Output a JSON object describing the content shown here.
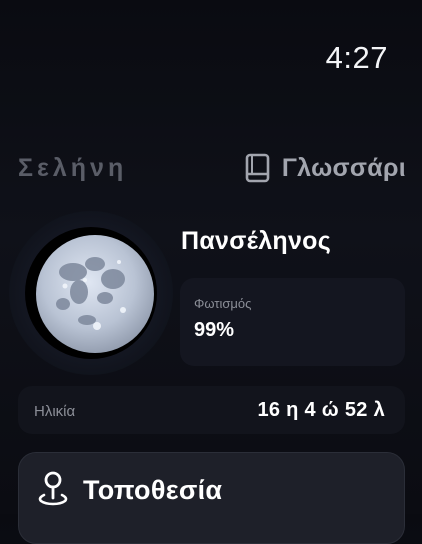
{
  "status_bar": {
    "time": "4:27"
  },
  "header": {
    "app_title": "Σελήνη",
    "glossary_icon": "book-icon",
    "glossary_label": "Γλωσσάρι"
  },
  "moon": {
    "icon": "full-moon-image",
    "phase_name": "Πανσέληνος",
    "illumination_label": "Φωτισμός",
    "illumination_value": "99%",
    "illumination_fraction": 0.99
  },
  "age": {
    "label": "Ηλικία",
    "value": "16 η 4 ώ 52 λ"
  },
  "location": {
    "icon": "location-pin-icon",
    "title": "Τοποθεσία"
  },
  "colors": {
    "background": "#0d0f16",
    "card": "#141620",
    "muted_text": "#8b8e97",
    "title_muted": "#5a5d67",
    "location_card": "#1e2029"
  }
}
